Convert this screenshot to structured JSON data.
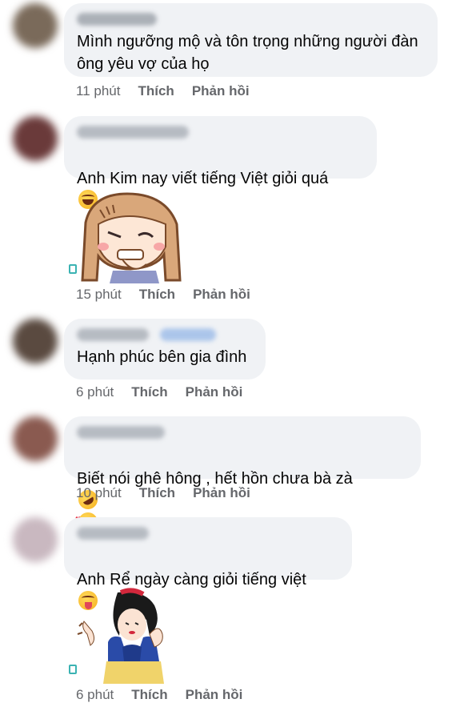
{
  "actions": {
    "like": "Thích",
    "reply": "Phản hồi"
  },
  "comments": [
    {
      "text": "Mình ngưỡng mộ và tôn trọng những người đàn\nông yêu vợ của họ",
      "time": "11 phút",
      "emoji": ""
    },
    {
      "text": "Anh Kim nay viết tiếng Việt giỏi quá",
      "time": "15 phút",
      "emoji": "grinning-squinting-face"
    },
    {
      "text": "Hạnh phúc bên gia đình",
      "time": "6 phút",
      "emoji": ""
    },
    {
      "text": "Biết nói ghê hông , hết hồn chưa bà zà",
      "time": "10 phút",
      "emoji": "rolling-on-floor-laughing, smiling-face-with-hearts"
    },
    {
      "text": "Anh Rể ngày càng giỏi tiếng việt",
      "time": "6 phút",
      "emoji": "squinting-face-with-tongue"
    }
  ],
  "colors": {
    "bubble": "#f0f2f5",
    "meta": "#65676b",
    "text": "#050505"
  }
}
